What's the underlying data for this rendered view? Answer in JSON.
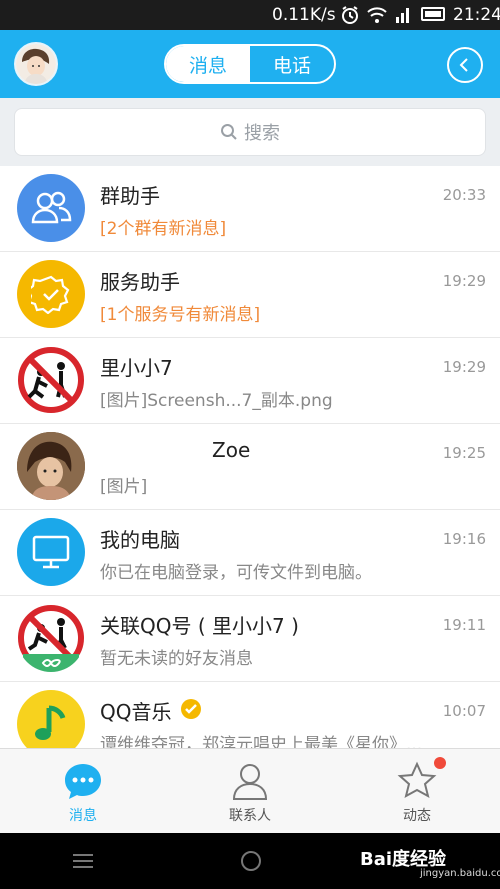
{
  "status_bar": {
    "speed": "0.11K/s",
    "time": "21:24"
  },
  "header": {
    "tabs": [
      {
        "label": "消息",
        "active": true
      },
      {
        "label": "电话",
        "active": false
      }
    ]
  },
  "search": {
    "placeholder": "搜索"
  },
  "conversations": [
    {
      "name": "群助手",
      "message": "[2个群有新消息]",
      "time": "20:33",
      "highlight": true,
      "avatar_icon": "group-icon",
      "avatar_color": "#4a8fe8"
    },
    {
      "name": "服务助手",
      "message": "[1个服务号有新消息]",
      "time": "19:29",
      "highlight": true,
      "avatar_icon": "badge-check-icon",
      "avatar_color": "#f5b800"
    },
    {
      "name": "里小小7",
      "message": "[图片]Screensh...7_副本.png",
      "time": "19:29",
      "highlight": false,
      "avatar_icon": "no-peeing-sign-icon",
      "avatar_color": "#ffffff"
    },
    {
      "name": "Zoe",
      "message": "[图片]",
      "time": "19:25",
      "highlight": false,
      "avatar_icon": "photo-avatar",
      "avatar_color": "#6b4a2e"
    },
    {
      "name": "我的电脑",
      "message": "你已在电脑登录，可传文件到电脑。",
      "time": "19:16",
      "highlight": false,
      "avatar_icon": "monitor-icon",
      "avatar_color": "#1ba8ea"
    },
    {
      "name": "关联QQ号 ( 里小小7 )",
      "message": "暂无未读的好友消息",
      "time": "19:11",
      "highlight": false,
      "avatar_icon": "no-peeing-sign-icon",
      "avatar_color": "#ffffff"
    },
    {
      "name": "QQ音乐",
      "message": "谭维维夺冠，郑淳元唱史上最美《星你》...",
      "time": "10:07",
      "highlight": false,
      "avatar_icon": "music-note-icon",
      "avatar_color": "#f7d21e"
    }
  ],
  "tab_bar": [
    {
      "label": "消息",
      "icon": "chat-bubble-icon",
      "active": true
    },
    {
      "label": "联系人",
      "icon": "contacts-icon",
      "active": false
    },
    {
      "label": "动态",
      "icon": "star-icon",
      "active": false,
      "badge": true
    }
  ],
  "watermark": {
    "logo": "Bai度经验",
    "url": "jingyan.baidu.com"
  }
}
